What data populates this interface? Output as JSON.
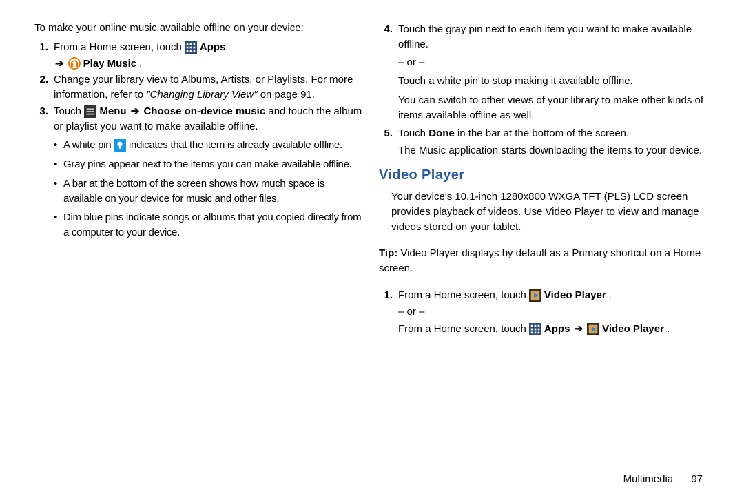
{
  "left": {
    "intro": "To make your online music available offline on your device:",
    "step1_pre": "From a Home screen, touch ",
    "step1_apps": "Apps",
    "step1_pm": "Play Music",
    "step1_period": ".",
    "step2_a": "Change your library view to Albums, Artists, or Playlists. For more information, refer to ",
    "step2_ref": "\"Changing Library View\"",
    "step2_b": " on page 91.",
    "step3_touch": "Touch ",
    "step3_menu": "Menu",
    "step3_choose": "Choose on-device music",
    "step3_rest": " and touch the album or playlist you want to make available offline.",
    "b1_a": "A white pin ",
    "b1_b": " indicates that the item is already available offline.",
    "b2": "Gray pins appear next to the items you can make available offline.",
    "b3": "A bar at the bottom of the screen shows how much space is available on your device for music and other files.",
    "b4": "Dim blue pins indicate songs or albums that you copied directly from a computer to your device."
  },
  "right": {
    "step4_a": "Touch the gray pin next to each item you want to make available offline.",
    "step4_or": "– or –",
    "step4_b": "Touch a white pin to stop making it available offline.",
    "step4_c": "You can switch to other views of your library to make other kinds of items available offline as well.",
    "step5_a": "Touch ",
    "step5_done": "Done",
    "step5_b": " in the bar at the bottom of the screen.",
    "step5_c": "The Music application starts downloading the items to your device.",
    "heading": "Video Player",
    "vp_intro": "Your device's 10.1-inch 1280x800 WXGA TFT (PLS) LCD screen provides playback of videos. Use Video Player to view and manage videos stored on your tablet.",
    "tip_label": "Tip:",
    "tip_body": " Video Player displays by default as a Primary shortcut on a Home screen.",
    "vp1_a": "From a Home screen, touch ",
    "vp1_vp": "Video Player",
    "vp1_period": ".",
    "vp1_or": "– or –",
    "vp1_b": "From a Home screen, touch ",
    "vp1_apps": "Apps",
    "vp1_vp2": "Video Player",
    "vp1_period2": "."
  },
  "footer": {
    "section": "Multimedia",
    "page": "97"
  },
  "arrow": "➔"
}
